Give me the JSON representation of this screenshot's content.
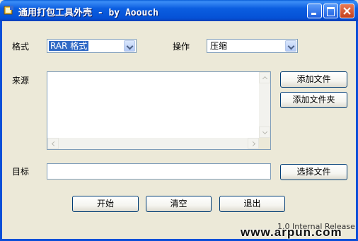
{
  "window": {
    "title": "通用打包工具外壳 - by Aoouch",
    "controls": {
      "minimize": "minimize-icon",
      "maximize": "maximize-icon",
      "close": "close-icon"
    }
  },
  "format": {
    "label": "格式",
    "selected": "RAR 格式"
  },
  "operation": {
    "label": "操作",
    "selected": "压缩"
  },
  "source": {
    "label": "来源",
    "items": []
  },
  "buttons": {
    "add_file": "添加文件",
    "add_folder": "添加文件夹",
    "choose_file": "选择文件",
    "start": "开始",
    "clear": "清空",
    "exit": "退出"
  },
  "target": {
    "label": "目标",
    "value": ""
  },
  "footer": {
    "release": "1.0 Internal Release",
    "watermark": "www.arpun.com"
  },
  "colors": {
    "titlebar": "#0a5fd8",
    "face": "#ece9d8",
    "selection": "#316ac5"
  }
}
